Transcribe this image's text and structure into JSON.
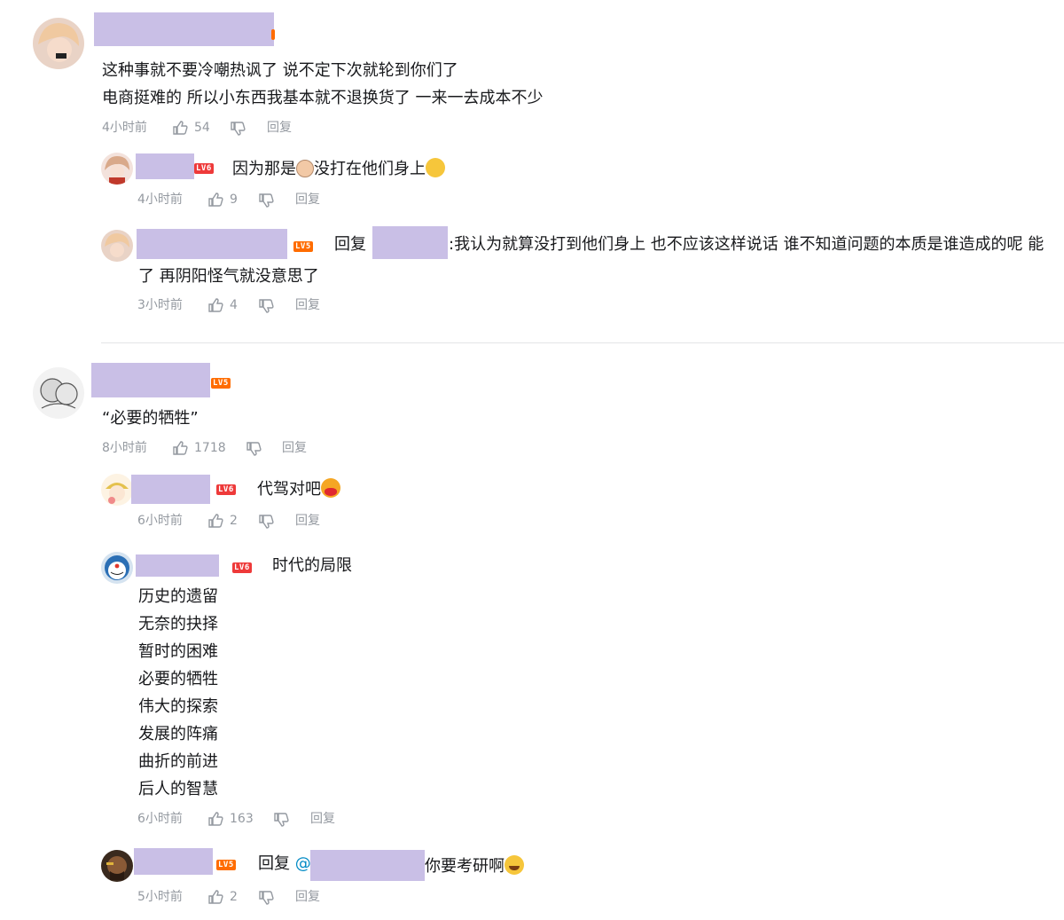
{
  "threads": [
    {
      "time": "4小时前",
      "likes": "54",
      "reply_label": "回复",
      "lines": [
        "这种事就不要冷嘲热讽了 说不定下次就轮到你们了",
        "电商挺难的 所以小东西我基本就不退换货了 一来一去成本不少"
      ],
      "replies": [
        {
          "level": "LV6",
          "text_before": "因为那是",
          "text_after": "没打在他们身上",
          "time": "4小时前",
          "likes": "9",
          "reply_label": "回复"
        },
        {
          "level": "LV5",
          "prefix": "回复",
          "text": ":我认为就算没打到他们身上 也不应该这样说话 谁不知道问题的本质是谁造成的呢 能",
          "text_cont": "了 再阴阳怪气就没意思了",
          "time": "3小时前",
          "likes": "4",
          "reply_label": "回复"
        }
      ]
    },
    {
      "level": "LV5",
      "time": "8小时前",
      "likes": "1718",
      "reply_label": "回复",
      "lines": [
        "“必要的牺牲”"
      ],
      "replies": [
        {
          "level": "LV6",
          "text": "代驾对吧",
          "time": "6小时前",
          "likes": "2",
          "reply_label": "回复"
        },
        {
          "level": "LV6",
          "text": "时代的局限",
          "extra_lines": [
            "历史的遗留",
            "无奈的抉择",
            "暂时的困难",
            "必要的牺牲",
            "伟大的探索",
            "发展的阵痛",
            "曲折的前进",
            "后人的智慧"
          ],
          "time": "6小时前",
          "likes": "163",
          "reply_label": "回复"
        },
        {
          "level": "LV5",
          "prefix": "回复",
          "at": "@",
          "text": "你要考研啊",
          "time": "5小时前",
          "likes": "2",
          "reply_label": "回复"
        }
      ]
    }
  ],
  "colors": {
    "redaction": "#c9bfe6",
    "meta": "#9499a0",
    "text": "#18191c",
    "lv5": "#ff6c00",
    "lv6": "#ee3a3a",
    "link": "#008ac5"
  }
}
